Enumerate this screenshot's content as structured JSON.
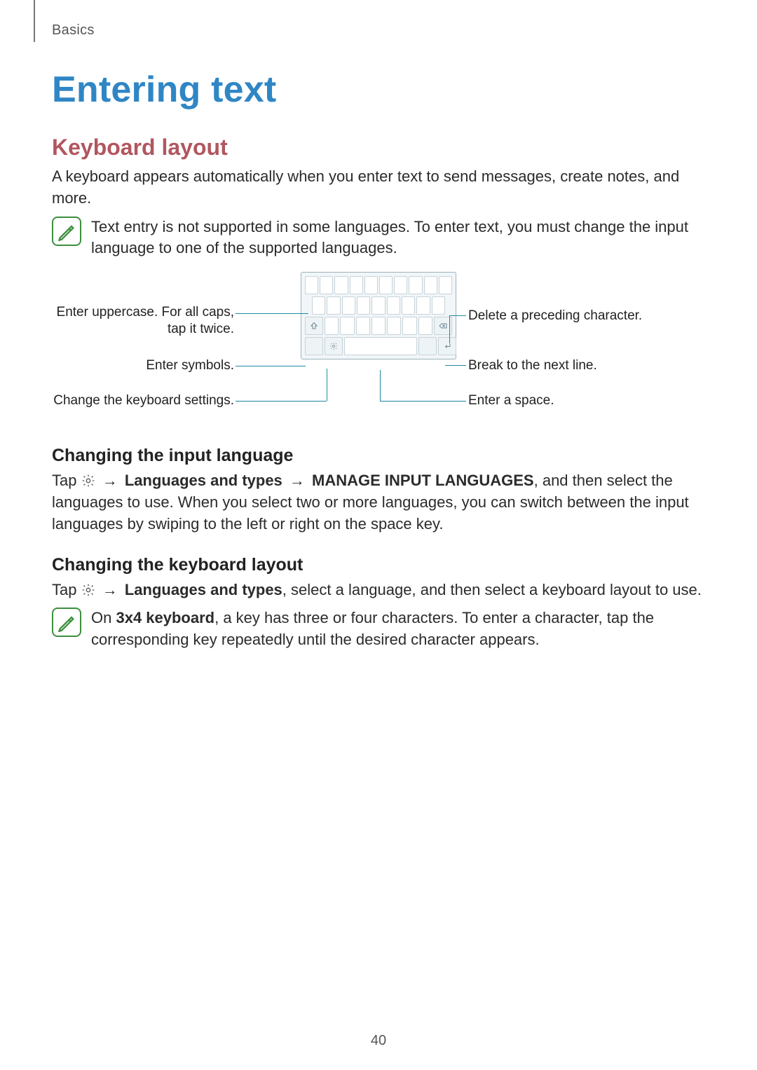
{
  "header": {
    "section": "Basics"
  },
  "title": "Entering text",
  "h2": "Keyboard layout",
  "intro": "A keyboard appears automatically when you enter text to send messages, create notes, and more.",
  "note1": "Text entry is not supported in some languages. To enter text, you must change the input language to one of the supported languages.",
  "callouts": {
    "left1": "Enter uppercase. For all caps, tap it twice.",
    "left2": "Enter symbols.",
    "left3": "Change the keyboard settings.",
    "right1": "Delete a preceding character.",
    "right2": "Break to the next line.",
    "right3": "Enter a space."
  },
  "h3a": "Changing the input language",
  "p1": {
    "pre": "Tap ",
    "arrow": "→",
    "b1": "Languages and types",
    "b2": "MANAGE INPUT LANGUAGES",
    "post": ", and then select the languages to use. When you select two or more languages, you can switch between the input languages by swiping to the left or right on the space key."
  },
  "h3b": "Changing the keyboard layout",
  "p2": {
    "pre": "Tap ",
    "arrow": "→",
    "b1": "Languages and types",
    "post": ", select a language, and then select a keyboard layout to use."
  },
  "note2": {
    "pre": "On ",
    "b": "3x4 keyboard",
    "post": ", a key has three or four characters. To enter a character, tap the corresponding key repeatedly until the desired character appears."
  },
  "page_number": "40"
}
